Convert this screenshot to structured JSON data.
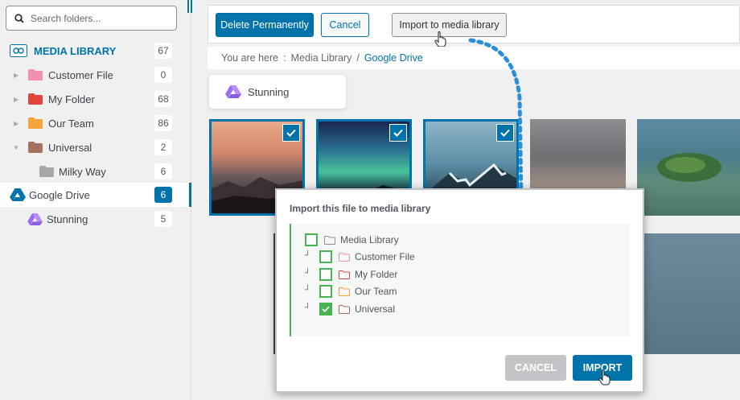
{
  "sidebar": {
    "search_placeholder": "Search folders...",
    "items": [
      {
        "label": "MEDIA LIBRARY",
        "count": "67"
      },
      {
        "label": "Customer File",
        "count": "0"
      },
      {
        "label": "My Folder",
        "count": "68"
      },
      {
        "label": "Our Team",
        "count": "86"
      },
      {
        "label": "Universal",
        "count": "2"
      },
      {
        "label": "Milky Way",
        "count": "6"
      },
      {
        "label": "Google Drive",
        "count": "6"
      },
      {
        "label": "Stunning",
        "count": "5"
      }
    ]
  },
  "toolbar": {
    "delete_label": "Delete Permanently",
    "cancel_label": "Cancel",
    "import_label": "Import to media library"
  },
  "breadcrumb": {
    "prefix": "You are here",
    "colon": ":",
    "crumbs": [
      "Media Library",
      "Google Drive"
    ],
    "separator": "/"
  },
  "main": {
    "folder_label": "Stunning"
  },
  "dialog": {
    "title": "Import this file to media library",
    "options": [
      {
        "label": "Media Library",
        "checked": false
      },
      {
        "label": "Customer File",
        "checked": false
      },
      {
        "label": "My Folder",
        "checked": false
      },
      {
        "label": "Our Team",
        "checked": false
      },
      {
        "label": "Universal",
        "checked": true
      }
    ],
    "cancel_label": "CANCEL",
    "import_label": "IMPORT"
  },
  "colors": {
    "accent": "#0073aa",
    "green": "#46b450",
    "pink": "#f18fb3",
    "red": "#e2463a",
    "orange": "#f5a33a",
    "brown": "#a5715f",
    "gray": "#a7a7a7",
    "drive_purple": "#9b6cf0"
  }
}
